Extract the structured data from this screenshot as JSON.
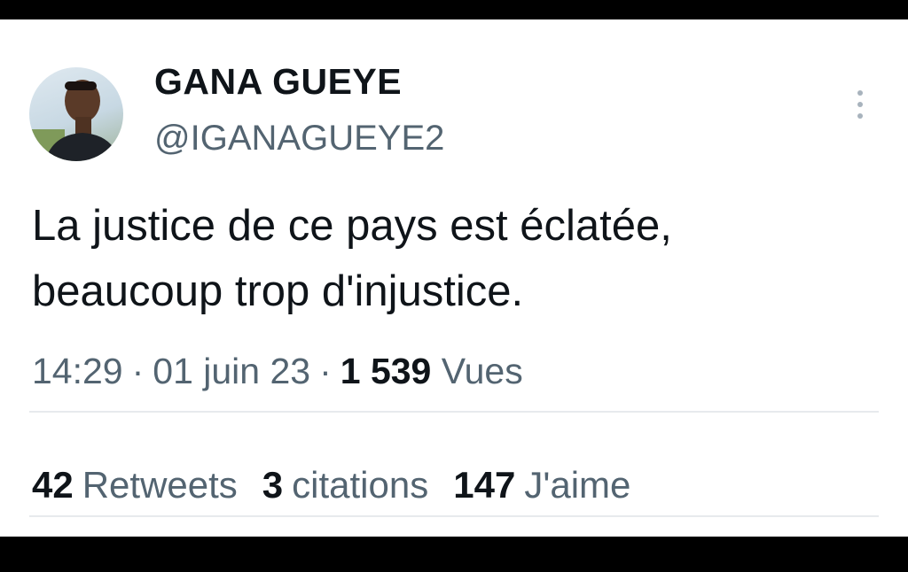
{
  "tweet": {
    "author": {
      "display_name": "GANA GUEYE",
      "handle": "@IGANAGUEYE2"
    },
    "text_lines": [
      "La justice de ce pays est éclatée,",
      "beaucoup trop d'injustice."
    ],
    "meta": {
      "time": "14:29",
      "separator": "·",
      "date": "01 juin 23",
      "views_count": "1 539",
      "views_label": "Vues"
    },
    "stats": {
      "retweets": {
        "count": "42",
        "label": "Retweets"
      },
      "quotes": {
        "count": "3",
        "label": "citations"
      },
      "likes": {
        "count": "147",
        "label": "J'aime"
      }
    }
  },
  "icons": {
    "more": "more-vertical-icon"
  },
  "colors": {
    "frame": "#000000",
    "card": "#ffffff",
    "text_primary": "#0f1419",
    "text_secondary": "#536471",
    "divider": "#e7eaed"
  }
}
